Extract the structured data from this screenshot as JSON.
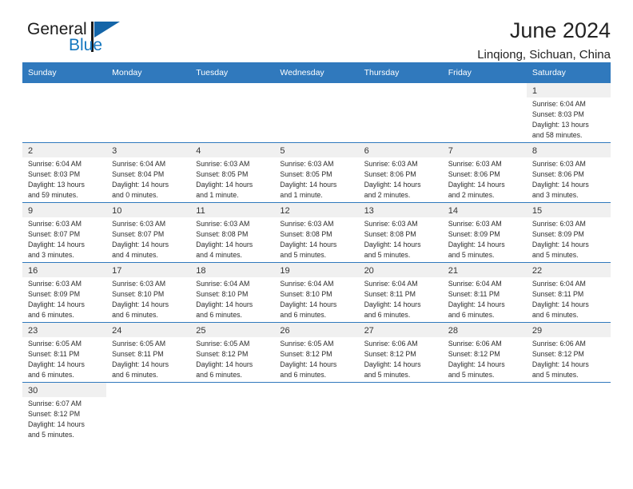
{
  "logo": {
    "word1": "General",
    "word2": "Blue",
    "triangle_color": "#1465a8",
    "blue_text_color": "#1477bf"
  },
  "header": {
    "title": "June 2024",
    "subtitle": "Linqiong, Sichuan, China"
  },
  "theme": {
    "header_blue": "#3079bd",
    "daynum_band": "#f0f0f0",
    "row_divider": "#3079bd"
  },
  "weekday_headers": [
    "Sunday",
    "Monday",
    "Tuesday",
    "Wednesday",
    "Thursday",
    "Friday",
    "Saturday"
  ],
  "weeks": [
    [
      {
        "empty": true
      },
      {
        "empty": true
      },
      {
        "empty": true
      },
      {
        "empty": true
      },
      {
        "empty": true
      },
      {
        "empty": true
      },
      {
        "day": "1",
        "sunrise": "Sunrise: 6:04 AM",
        "sunset": "Sunset: 8:03 PM",
        "daylight_1": "Daylight: 13 hours",
        "daylight_2": "and 58 minutes."
      }
    ],
    [
      {
        "day": "2",
        "sunrise": "Sunrise: 6:04 AM",
        "sunset": "Sunset: 8:03 PM",
        "daylight_1": "Daylight: 13 hours",
        "daylight_2": "and 59 minutes."
      },
      {
        "day": "3",
        "sunrise": "Sunrise: 6:04 AM",
        "sunset": "Sunset: 8:04 PM",
        "daylight_1": "Daylight: 14 hours",
        "daylight_2": "and 0 minutes."
      },
      {
        "day": "4",
        "sunrise": "Sunrise: 6:03 AM",
        "sunset": "Sunset: 8:05 PM",
        "daylight_1": "Daylight: 14 hours",
        "daylight_2": "and 1 minute."
      },
      {
        "day": "5",
        "sunrise": "Sunrise: 6:03 AM",
        "sunset": "Sunset: 8:05 PM",
        "daylight_1": "Daylight: 14 hours",
        "daylight_2": "and 1 minute."
      },
      {
        "day": "6",
        "sunrise": "Sunrise: 6:03 AM",
        "sunset": "Sunset: 8:06 PM",
        "daylight_1": "Daylight: 14 hours",
        "daylight_2": "and 2 minutes."
      },
      {
        "day": "7",
        "sunrise": "Sunrise: 6:03 AM",
        "sunset": "Sunset: 8:06 PM",
        "daylight_1": "Daylight: 14 hours",
        "daylight_2": "and 2 minutes."
      },
      {
        "day": "8",
        "sunrise": "Sunrise: 6:03 AM",
        "sunset": "Sunset: 8:06 PM",
        "daylight_1": "Daylight: 14 hours",
        "daylight_2": "and 3 minutes."
      }
    ],
    [
      {
        "day": "9",
        "sunrise": "Sunrise: 6:03 AM",
        "sunset": "Sunset: 8:07 PM",
        "daylight_1": "Daylight: 14 hours",
        "daylight_2": "and 3 minutes."
      },
      {
        "day": "10",
        "sunrise": "Sunrise: 6:03 AM",
        "sunset": "Sunset: 8:07 PM",
        "daylight_1": "Daylight: 14 hours",
        "daylight_2": "and 4 minutes."
      },
      {
        "day": "11",
        "sunrise": "Sunrise: 6:03 AM",
        "sunset": "Sunset: 8:08 PM",
        "daylight_1": "Daylight: 14 hours",
        "daylight_2": "and 4 minutes."
      },
      {
        "day": "12",
        "sunrise": "Sunrise: 6:03 AM",
        "sunset": "Sunset: 8:08 PM",
        "daylight_1": "Daylight: 14 hours",
        "daylight_2": "and 5 minutes."
      },
      {
        "day": "13",
        "sunrise": "Sunrise: 6:03 AM",
        "sunset": "Sunset: 8:08 PM",
        "daylight_1": "Daylight: 14 hours",
        "daylight_2": "and 5 minutes."
      },
      {
        "day": "14",
        "sunrise": "Sunrise: 6:03 AM",
        "sunset": "Sunset: 8:09 PM",
        "daylight_1": "Daylight: 14 hours",
        "daylight_2": "and 5 minutes."
      },
      {
        "day": "15",
        "sunrise": "Sunrise: 6:03 AM",
        "sunset": "Sunset: 8:09 PM",
        "daylight_1": "Daylight: 14 hours",
        "daylight_2": "and 5 minutes."
      }
    ],
    [
      {
        "day": "16",
        "sunrise": "Sunrise: 6:03 AM",
        "sunset": "Sunset: 8:09 PM",
        "daylight_1": "Daylight: 14 hours",
        "daylight_2": "and 6 minutes."
      },
      {
        "day": "17",
        "sunrise": "Sunrise: 6:03 AM",
        "sunset": "Sunset: 8:10 PM",
        "daylight_1": "Daylight: 14 hours",
        "daylight_2": "and 6 minutes."
      },
      {
        "day": "18",
        "sunrise": "Sunrise: 6:04 AM",
        "sunset": "Sunset: 8:10 PM",
        "daylight_1": "Daylight: 14 hours",
        "daylight_2": "and 6 minutes."
      },
      {
        "day": "19",
        "sunrise": "Sunrise: 6:04 AM",
        "sunset": "Sunset: 8:10 PM",
        "daylight_1": "Daylight: 14 hours",
        "daylight_2": "and 6 minutes."
      },
      {
        "day": "20",
        "sunrise": "Sunrise: 6:04 AM",
        "sunset": "Sunset: 8:11 PM",
        "daylight_1": "Daylight: 14 hours",
        "daylight_2": "and 6 minutes."
      },
      {
        "day": "21",
        "sunrise": "Sunrise: 6:04 AM",
        "sunset": "Sunset: 8:11 PM",
        "daylight_1": "Daylight: 14 hours",
        "daylight_2": "and 6 minutes."
      },
      {
        "day": "22",
        "sunrise": "Sunrise: 6:04 AM",
        "sunset": "Sunset: 8:11 PM",
        "daylight_1": "Daylight: 14 hours",
        "daylight_2": "and 6 minutes."
      }
    ],
    [
      {
        "day": "23",
        "sunrise": "Sunrise: 6:05 AM",
        "sunset": "Sunset: 8:11 PM",
        "daylight_1": "Daylight: 14 hours",
        "daylight_2": "and 6 minutes."
      },
      {
        "day": "24",
        "sunrise": "Sunrise: 6:05 AM",
        "sunset": "Sunset: 8:11 PM",
        "daylight_1": "Daylight: 14 hours",
        "daylight_2": "and 6 minutes."
      },
      {
        "day": "25",
        "sunrise": "Sunrise: 6:05 AM",
        "sunset": "Sunset: 8:12 PM",
        "daylight_1": "Daylight: 14 hours",
        "daylight_2": "and 6 minutes."
      },
      {
        "day": "26",
        "sunrise": "Sunrise: 6:05 AM",
        "sunset": "Sunset: 8:12 PM",
        "daylight_1": "Daylight: 14 hours",
        "daylight_2": "and 6 minutes."
      },
      {
        "day": "27",
        "sunrise": "Sunrise: 6:06 AM",
        "sunset": "Sunset: 8:12 PM",
        "daylight_1": "Daylight: 14 hours",
        "daylight_2": "and 5 minutes."
      },
      {
        "day": "28",
        "sunrise": "Sunrise: 6:06 AM",
        "sunset": "Sunset: 8:12 PM",
        "daylight_1": "Daylight: 14 hours",
        "daylight_2": "and 5 minutes."
      },
      {
        "day": "29",
        "sunrise": "Sunrise: 6:06 AM",
        "sunset": "Sunset: 8:12 PM",
        "daylight_1": "Daylight: 14 hours",
        "daylight_2": "and 5 minutes."
      }
    ],
    [
      {
        "day": "30",
        "sunrise": "Sunrise: 6:07 AM",
        "sunset": "Sunset: 8:12 PM",
        "daylight_1": "Daylight: 14 hours",
        "daylight_2": "and 5 minutes."
      },
      {
        "empty": true
      },
      {
        "empty": true
      },
      {
        "empty": true
      },
      {
        "empty": true
      },
      {
        "empty": true
      },
      {
        "empty": true
      }
    ]
  ]
}
